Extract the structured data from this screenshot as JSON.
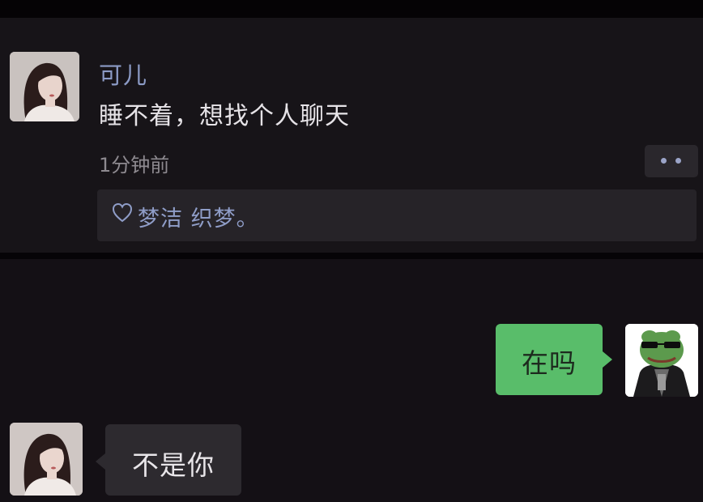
{
  "post": {
    "author": "可儿",
    "text": "睡不着，想找个人聊天",
    "time": "1分钟前",
    "more_icon": "more-dots-icon",
    "likes": {
      "icon": "heart-icon",
      "names": "梦洁  织梦。"
    }
  },
  "chat": {
    "messages": [
      {
        "sender": "me",
        "text": "在吗"
      },
      {
        "sender": "other",
        "text": "不是你"
      }
    ]
  },
  "colors": {
    "name_link": "#8c9bc6",
    "my_bubble": "#59bd6a",
    "their_bubble": "#2d2a2f",
    "background": "#141015"
  }
}
